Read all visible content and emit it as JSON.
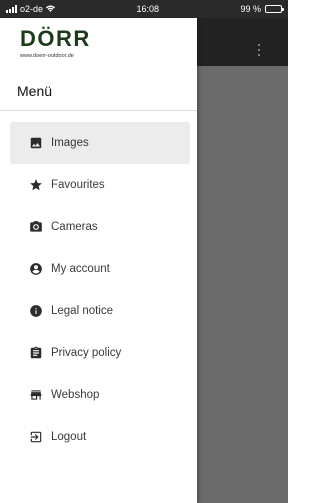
{
  "status_bar": {
    "carrier": "o2-de",
    "time": "16:08",
    "battery": "99 %",
    "battery_level": 0.99
  },
  "brand": {
    "logo": "DÖRR",
    "url": "www.doerr-outdoor.de"
  },
  "menu": {
    "title": "Menü"
  },
  "nav": {
    "items": [
      {
        "label": "Images",
        "icon": "image-icon",
        "active": true
      },
      {
        "label": "Favourites",
        "icon": "star-icon",
        "active": false
      },
      {
        "label": "Cameras",
        "icon": "camera-icon",
        "active": false
      },
      {
        "label": "My account",
        "icon": "account-icon",
        "active": false
      },
      {
        "label": "Legal notice",
        "icon": "info-icon",
        "active": false
      },
      {
        "label": "Privacy policy",
        "icon": "clipboard-icon",
        "active": false
      },
      {
        "label": "Webshop",
        "icon": "store-icon",
        "active": false
      },
      {
        "label": "Logout",
        "icon": "logout-icon",
        "active": false
      }
    ]
  },
  "colors": {
    "active_bg": "#ececec",
    "backdrop": "#6b6b6b",
    "app_bar": "#232323",
    "brand": "#1b3b1b"
  }
}
